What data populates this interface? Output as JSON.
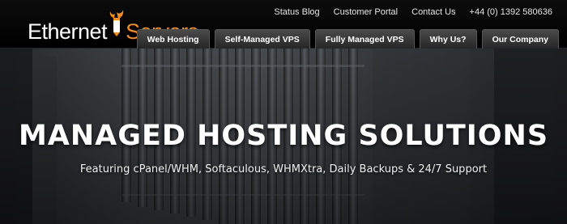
{
  "logo": {
    "part1": "Ethernet",
    "part2": "Servers"
  },
  "top_links": [
    {
      "label": "Status Blog"
    },
    {
      "label": "Customer Portal"
    },
    {
      "label": "Contact Us"
    },
    {
      "label": "+44 (0) 1392 580636"
    }
  ],
  "nav": [
    {
      "label": "Web Hosting"
    },
    {
      "label": "Self-Managed VPS"
    },
    {
      "label": "Fully Managed VPS"
    },
    {
      "label": "Why Us?"
    },
    {
      "label": "Our Company"
    }
  ],
  "hero": {
    "title": "MANAGED HOSTING SOLUTIONS",
    "subtitle": "Featuring cPanel/WHM, Softaculous, WHMXtra, Daily Backups & 24/7 Support"
  },
  "colors": {
    "brand_orange": "#f28c1a",
    "header_bg": "#000000",
    "nav_tab_bg": "#3a3a3a"
  }
}
